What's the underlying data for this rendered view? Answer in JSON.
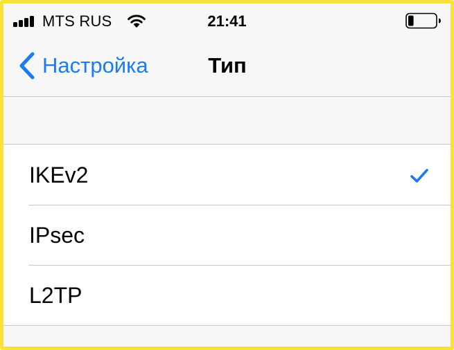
{
  "status_bar": {
    "carrier": "MTS RUS",
    "time": "21:41",
    "signal_bars": 4,
    "battery_level": 0.2,
    "icons": [
      "signal-icon",
      "wifi-icon",
      "battery-icon"
    ]
  },
  "nav": {
    "back_label": "Настройка",
    "title": "Тип",
    "back_icon": "chevron-left-icon"
  },
  "options": [
    {
      "label": "IKEv2",
      "selected": true
    },
    {
      "label": "IPsec",
      "selected": false
    },
    {
      "label": "L2TP",
      "selected": false
    }
  ],
  "colors": {
    "accent": "#1a7cf0",
    "frame": "#f9e33a",
    "background": "#f7f7f7",
    "separator": "#c8c7cc"
  }
}
